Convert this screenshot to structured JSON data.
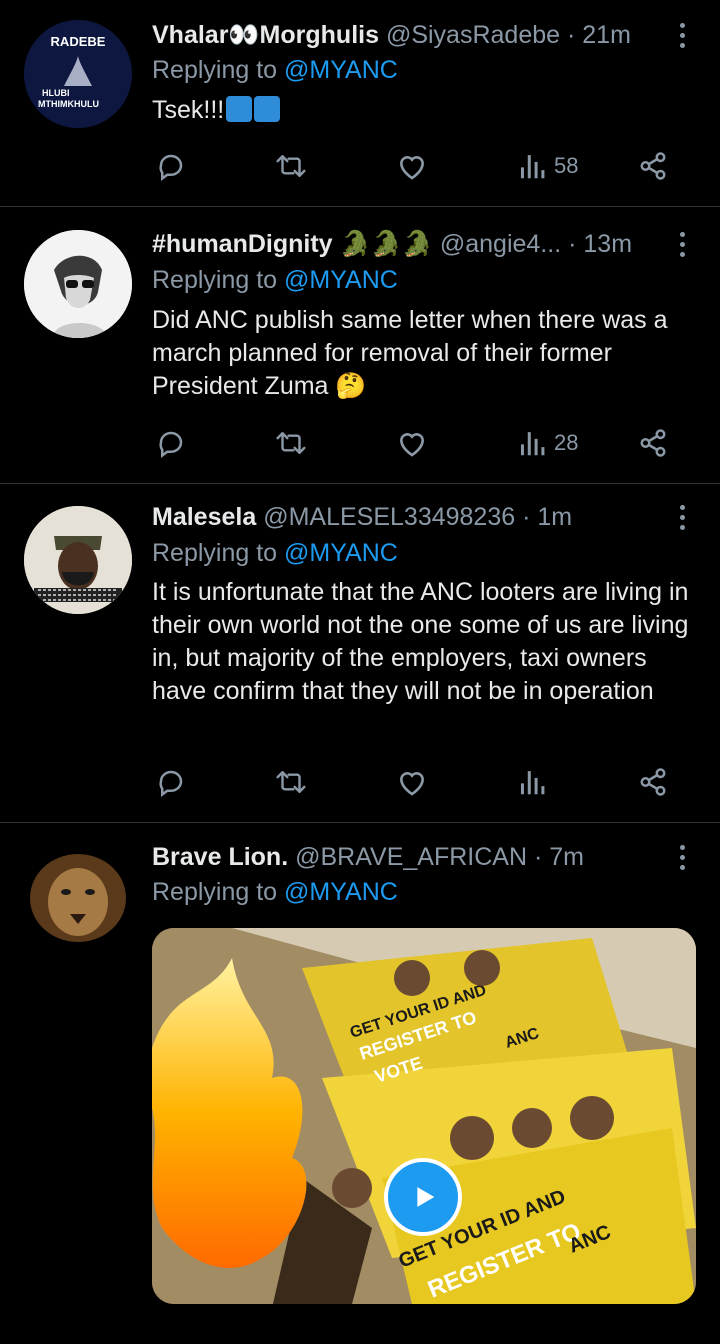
{
  "tweets": [
    {
      "name": "Vhalar👀Morghulis",
      "handle": "@SiyasRadebe",
      "time": "21m",
      "replying_prefix": "Replying to",
      "replying_to": "@MYANC",
      "text": "Tsek!!!",
      "avatar_text": [
        "RADEBE",
        "HLUBI",
        "MTHIMKHULU"
      ],
      "views": "58"
    },
    {
      "name": "#humanDignity 🐊🐊🐊",
      "handle": "@angie4...",
      "time": "13m",
      "replying_prefix": "Replying to",
      "replying_to": "@MYANC",
      "text": "Did ANC publish same letter when there was a march planned for removal of their former President Zuma 🤔",
      "views": "28"
    },
    {
      "name": "Malesela",
      "handle": "@MALESEL33498236",
      "time": "1m",
      "replying_prefix": "Replying to",
      "replying_to": "@MYANC",
      "text": "It is unfortunate that the ANC looters are living in their own world not the one some of us are living in, but majority of the employers, taxi owners have confirm that they will not be in operation",
      "views": ""
    },
    {
      "name": "Brave Lion.",
      "handle": "@BRAVE_AFRICAN",
      "time": "7m",
      "replying_prefix": "Replying to",
      "replying_to": "@MYANC",
      "media_text": [
        "GET YOUR ID AND",
        "REGISTER TO",
        "VOTE",
        "ANC"
      ]
    }
  ],
  "separator": "·",
  "colors": {
    "background": "#000000",
    "text": "#e7e9ea",
    "muted": "#8b98a5",
    "link": "#1d9bf0",
    "divider": "#2f3336"
  },
  "icons": [
    "reply-icon",
    "retweet-icon",
    "like-icon",
    "views-icon",
    "share-icon",
    "more-icon",
    "play-icon"
  ]
}
